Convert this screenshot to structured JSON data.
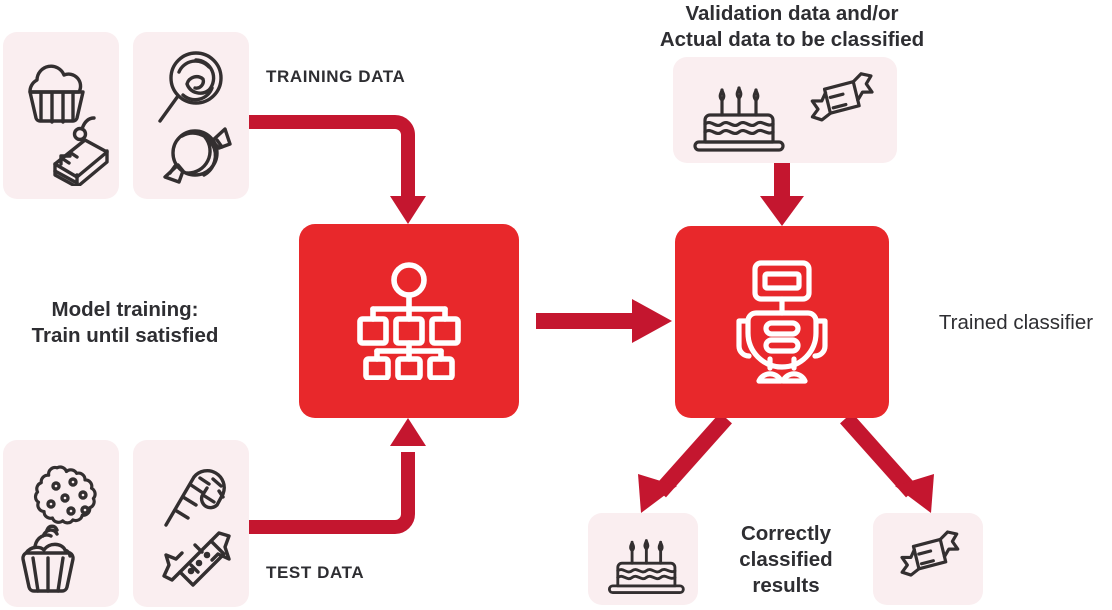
{
  "diagram": {
    "title": "Machine learning training and classification flow",
    "colors": {
      "card_background": "#faeef0",
      "box_red": "#e8282b",
      "arrow_crimson": "#c4162f",
      "icon_stroke": "#332f30",
      "text": "#2e2e32"
    }
  },
  "labels": {
    "training_data": "TRAINING DATA",
    "test_data": "TEST DATA",
    "model_training": "Model training:\nTrain until satisfied",
    "validation_data": "Validation data and/or\nActual data to be classified",
    "trained_classifier": "Trained classifier",
    "correct_results": "Correctly\nclassified\nresults"
  },
  "cards": [
    {
      "id": "train-sweets-1",
      "icons": [
        "cupcake-icon",
        "cake-slice-icon"
      ]
    },
    {
      "id": "train-sweets-2",
      "icons": [
        "lollipop-icon",
        "round-candy-icon"
      ]
    },
    {
      "id": "test-sweets-1",
      "icons": [
        "cookie-icon",
        "frosted-cupcake-icon"
      ]
    },
    {
      "id": "test-sweets-2",
      "icons": [
        "candy-cane-icon",
        "candy-bar-icon"
      ]
    },
    {
      "id": "validation-data",
      "icons": [
        "birthday-cake-icon",
        "wrapped-candy-icon"
      ]
    },
    {
      "id": "result-cake",
      "icons": [
        "birthday-cake-icon"
      ]
    },
    {
      "id": "result-candy",
      "icons": [
        "wrapped-candy-icon"
      ]
    }
  ],
  "boxes": [
    {
      "id": "model-box",
      "icon": "decision-tree-icon"
    },
    {
      "id": "classifier-box",
      "icon": "robot-icon"
    }
  ],
  "arrows": [
    {
      "id": "training-data-arrow",
      "from": "train-sweets-2",
      "to": "model-box"
    },
    {
      "id": "test-data-arrow",
      "from": "test-sweets-2",
      "to": "model-box"
    },
    {
      "id": "model-to-classifier-arrow",
      "from": "model-box",
      "to": "classifier-box"
    },
    {
      "id": "validation-to-classifier-arrow",
      "from": "validation-data",
      "to": "classifier-box"
    },
    {
      "id": "classifier-to-cake-arrow",
      "from": "classifier-box",
      "to": "result-cake"
    },
    {
      "id": "classifier-to-candy-arrow",
      "from": "classifier-box",
      "to": "result-candy"
    }
  ]
}
